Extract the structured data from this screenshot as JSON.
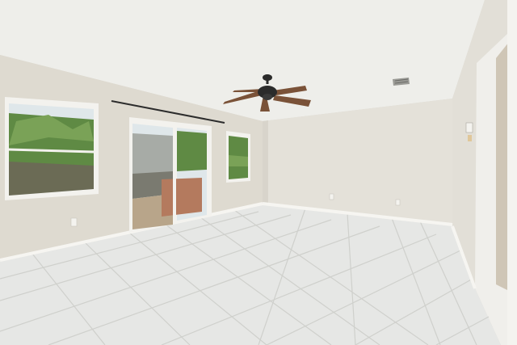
{
  "scene": {
    "kind": "empty-room-interior",
    "elements": [
      "ceiling",
      "ceiling-fan",
      "air-vent",
      "left-wall",
      "back-wall",
      "right-wall",
      "window-left",
      "sliding-glass-door",
      "window-center",
      "doorway-right",
      "tile-floor",
      "baseboards",
      "electrical-outlets",
      "wall-thermostat"
    ],
    "colors": {
      "ceiling": "#eeeeea",
      "wall_left": "#dedad0",
      "wall_back": "#e3e0d8",
      "wall_right": "#e2dfd7",
      "floor": "#e7e8e6",
      "grout": "#cfcfcb",
      "trim": "#f4f3ef",
      "fan_blade": "#7a5238",
      "fan_body": "#2b2b2b",
      "foliage": "#5f8a44",
      "sky": "#dfe7ea",
      "brick": "#b47a5e"
    }
  }
}
